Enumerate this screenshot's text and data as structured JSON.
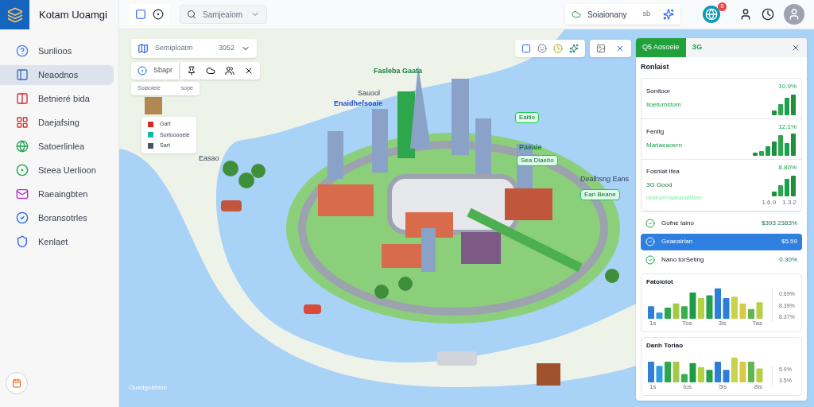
{
  "app": {
    "title": "Kotam Uoamgi"
  },
  "sidebar": {
    "items": [
      {
        "label": "Sunlioos",
        "selected": false
      },
      {
        "label": "Neaodnos",
        "selected": true
      },
      {
        "label": "Betnieré bida",
        "selected": false
      },
      {
        "label": "Daejafsing",
        "selected": false
      },
      {
        "label": "Satoerlinlea",
        "selected": false
      },
      {
        "label": "Steea Uerlioon",
        "selected": false
      },
      {
        "label": "Raeaingbten",
        "selected": false
      },
      {
        "label": "Boransotrles",
        "selected": false
      },
      {
        "label": "Kenlaet",
        "selected": false
      }
    ]
  },
  "topbar": {
    "search": {
      "value": "Samjeaiom"
    },
    "status": {
      "label": "Soiaionany",
      "count": "sb"
    },
    "notification_count": "8"
  },
  "map": {
    "search_card": {
      "value": "Semiploatm",
      "count": "3052"
    },
    "toolbar": {
      "label": "Sbapr"
    },
    "filter_row": {
      "label": "Soiaoieie",
      "value": "sope"
    },
    "legend": [
      {
        "label": "Gart",
        "color": "#dc2626"
      },
      {
        "label": "Surtooooeie",
        "color": "#14b8a6"
      },
      {
        "label": "Sart",
        "color": "#475569"
      }
    ],
    "labels": [
      {
        "text": "Sauool",
        "kind": "plain"
      },
      {
        "text": "Fasleba Gaata",
        "kind": "green"
      },
      {
        "text": "Enaidhefsoaie",
        "kind": "blue"
      },
      {
        "text": "Eaitio",
        "kind": "tag"
      },
      {
        "text": "Paeaie",
        "kind": "green"
      },
      {
        "text": "Sea Diaebo",
        "kind": "tag"
      },
      {
        "text": "Dealhsng Eans",
        "kind": "plain"
      },
      {
        "text": "Ean Beane",
        "kind": "tag"
      },
      {
        "text": "Easao",
        "kind": "plain"
      }
    ],
    "attribution": "Ouedgobhinn"
  },
  "panel": {
    "tabs": [
      {
        "label": "Q5 Aosoeie",
        "selected": true
      },
      {
        "label": "ЗG",
        "selected": false
      }
    ],
    "heading": "Ronlaist",
    "cards": [
      {
        "title": "Sonitoor",
        "value": "10.9%",
        "subtitle": "Iloetumstom"
      },
      {
        "title": "Fenltg",
        "value": "12.1%",
        "subtitle": "Mariaeaoern"
      },
      {
        "title": "Fosniat Ifea",
        "value": "8.80%",
        "subtitle": "3G Good",
        "note": "oeaeaemaaeanatlatan",
        "axis": [
          "1.6.9",
          "1.3.2"
        ]
      }
    ],
    "rows": [
      {
        "label": "Gofne laino",
        "value": "$393 2383%",
        "selected": false
      },
      {
        "label": "Geaeairlan",
        "value": "$5.59",
        "selected": true
      },
      {
        "label": "Nano torSeting",
        "value": "0.30%",
        "selected": false
      }
    ],
    "charts": [
      {
        "title": "Fatoiolot",
        "x_labels": [
          "1s",
          "Tos",
          "3is",
          "Tas"
        ],
        "side_labels": [
          "0.69%",
          "8.39%",
          "8.37%"
        ]
      },
      {
        "title": "Danh Toriao",
        "x_labels": [
          "1s",
          "tos",
          "5is",
          "8is"
        ],
        "side_labels": [
          "5.9%",
          "3.5%"
        ]
      }
    ]
  }
}
